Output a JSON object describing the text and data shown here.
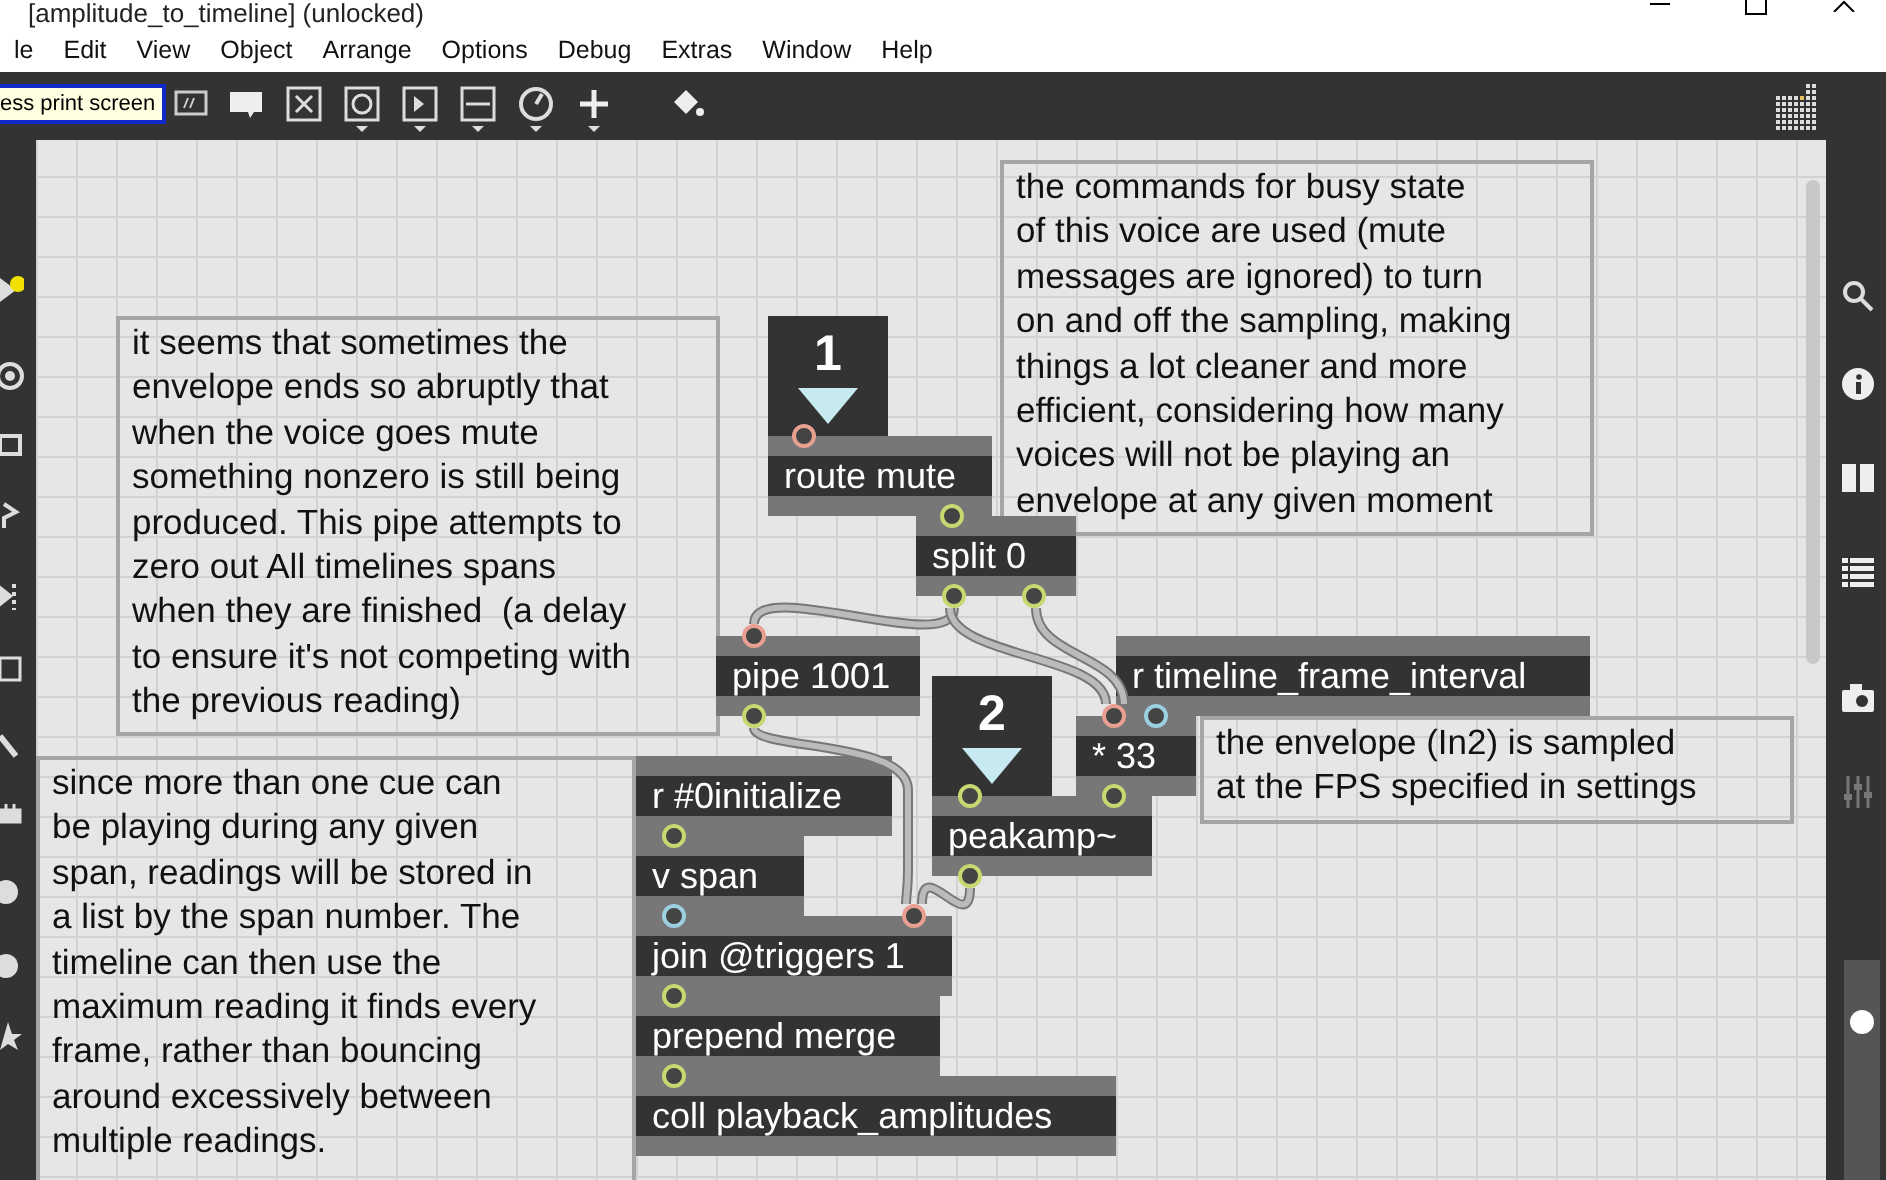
{
  "window": {
    "title": "[amplitude_to_timeline] (unlocked)"
  },
  "menu": [
    "le",
    "Edit",
    "View",
    "Object",
    "Arrange",
    "Options",
    "Debug",
    "Extras",
    "Window",
    "Help"
  ],
  "toolbar": {
    "tooltip": "ess print screen"
  },
  "patcher": {
    "markers": [
      {
        "number": "1"
      },
      {
        "number": "2"
      }
    ],
    "objects": [
      {
        "text": "route mute"
      },
      {
        "text": "split 0"
      },
      {
        "text": "pipe 1001"
      },
      {
        "text": "r timeline_frame_interval"
      },
      {
        "text": "* 33"
      },
      {
        "text": "peakamp~"
      },
      {
        "text": "r #0initialize"
      },
      {
        "text": "v span"
      },
      {
        "text": "join @triggers 1"
      },
      {
        "text": "prepend merge"
      },
      {
        "text": "coll playback_amplitudes"
      }
    ],
    "comments": [
      {
        "text": "it seems that sometimes the\nenvelope ends so abruptly that\nwhen the voice goes mute\nsomething nonzero is still being\nproduced. This pipe attempts to\nzero out All timelines spans\nwhen they are finished  (a delay\nto ensure it's not competing with\nthe previous reading)"
      },
      {
        "text": "the commands for busy state\nof this voice are used (mute\nmessages are ignored) to turn\non and off the sampling, making\nthings a lot cleaner and more\nefficient, considering how many\nvoices will not be playing an\nenvelope at any given moment"
      },
      {
        "text": "since more than one cue can\nbe playing during any given\nspan, readings will be stored in\na list by the span number. The\ntimeline can then use the\nmaximum reading it finds every\nframe, rather than bouncing\naround excessively between\nmultiple readings."
      },
      {
        "text": "the envelope (In2) is sampled\nat the FPS specified in settings"
      }
    ]
  },
  "volume": {
    "level": 0.75
  }
}
